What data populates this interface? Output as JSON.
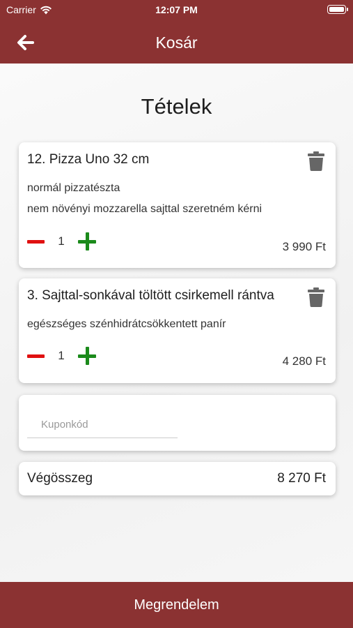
{
  "status_bar": {
    "carrier": "Carrier",
    "time": "12:07 PM"
  },
  "header": {
    "title": "Kosár",
    "back_icon": "arrow-left-icon"
  },
  "page": {
    "title": "Tételek"
  },
  "cart": {
    "items": [
      {
        "name": "12. Pizza Uno 32 cm",
        "options": [
          "normál pizzatészta",
          "nem növényi mozzarella sajttal szeretném kérni"
        ],
        "quantity": "1",
        "price": "3 990 Ft"
      },
      {
        "name": "3. Sajttal-sonkával töltött csirkemell rántva",
        "options": [
          "egészséges szénhidrátcsökkentett panír"
        ],
        "quantity": "1",
        "price": "4 280 Ft"
      }
    ]
  },
  "coupon": {
    "placeholder": "Kuponkód",
    "value": ""
  },
  "total": {
    "label": "Végösszeg",
    "value": "8 270 Ft"
  },
  "footer": {
    "order_label": "Megrendelem"
  },
  "colors": {
    "brand": "#8b3232",
    "minus": "#e01010",
    "plus": "#1b8a1b",
    "trash": "#666666"
  }
}
